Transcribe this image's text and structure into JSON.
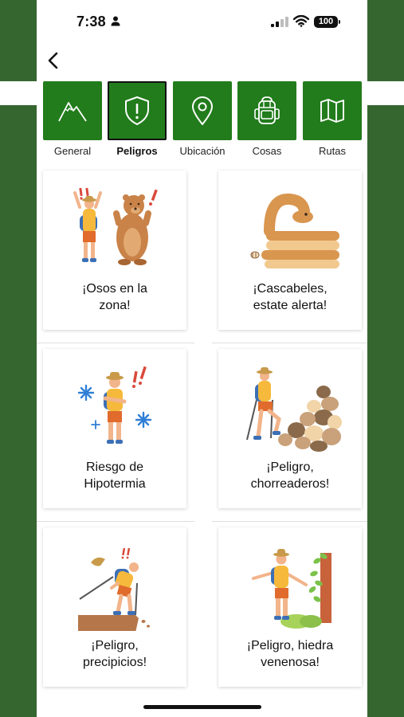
{
  "status": {
    "time": "7:38",
    "battery": "100"
  },
  "nav": {
    "back_icon": "chevron-left-icon"
  },
  "tabs": [
    {
      "label": "General",
      "icon": "mountain-icon",
      "active": false
    },
    {
      "label": "Peligros",
      "icon": "shield-alert-icon",
      "active": true
    },
    {
      "label": "Ubicación",
      "icon": "location-pin-icon",
      "active": false
    },
    {
      "label": "Cosas",
      "icon": "backpack-icon",
      "active": false
    },
    {
      "label": "Rutas",
      "icon": "map-icon",
      "active": false
    }
  ],
  "cards": [
    {
      "line1": "¡Osos en la",
      "line2": "zona!",
      "icon": "bear-hiker-illustration"
    },
    {
      "line1": "¡Cascabeles,",
      "line2": "estate alerta!",
      "icon": "rattlesnake-illustration"
    },
    {
      "line1": "Riesgo de",
      "line2": "Hipotermia",
      "icon": "hypothermia-hiker-illustration"
    },
    {
      "line1": "¡Peligro,",
      "line2": "chorreaderos!",
      "icon": "rockslide-hiker-illustration"
    },
    {
      "line1": "¡Peligro,",
      "line2": "precipicios!",
      "icon": "cliff-hiker-illustration"
    },
    {
      "line1": "¡Peligro, hiedra",
      "line2": "venenosa!",
      "icon": "poison-ivy-illustration"
    }
  ],
  "colors": {
    "accent": "#227c1c",
    "side_background": "#366630"
  }
}
